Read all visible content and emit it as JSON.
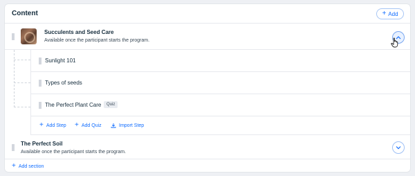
{
  "header": {
    "title": "Content",
    "add_label": "Add"
  },
  "sections": [
    {
      "title": "Succulents and Seed Care",
      "subtitle": "Available once the participant starts the program.",
      "expanded": true,
      "steps": [
        {
          "label": "Sunlight 101",
          "badge": ""
        },
        {
          "label": "Types of seeds",
          "badge": ""
        },
        {
          "label": "The Perfect Plant Care",
          "badge": "Quiz"
        }
      ],
      "actions": {
        "add_step": "Add Step",
        "add_quiz": "Add Quiz",
        "import_step": "Import Step"
      }
    },
    {
      "title": "The Perfect Soil",
      "subtitle": "Available once the participant starts the program.",
      "expanded": false
    }
  ],
  "footer": {
    "add_section_label": "Add section"
  },
  "colors": {
    "accent": "#116dff",
    "background": "#eef0f4"
  },
  "icons": {
    "collapse": "chevron-up-icon",
    "expand": "chevron-down-icon",
    "drag": "drag-handle-icon",
    "add": "plus-icon",
    "import": "download-icon"
  }
}
